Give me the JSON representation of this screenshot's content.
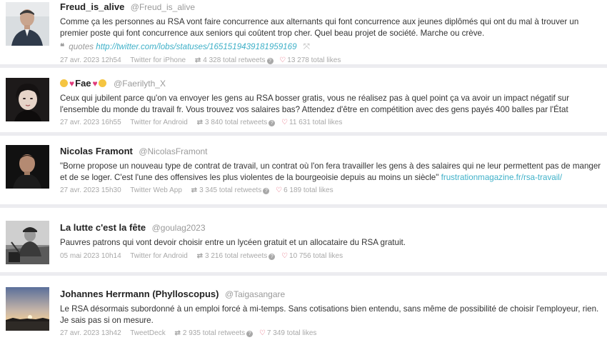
{
  "tweets": [
    {
      "name": "Freud_is_alive",
      "handle": "@Freud_is_alive",
      "text": "Comme ça les personnes au RSA vont faire concurrence aux alternants qui font concurrence aux jeunes diplômés qui ont du mal à trouver un premier poste qui font concurrence aux seniors qui coûtent trop cher. Quel beau projet de société. Marche ou crève.",
      "quote_label": "quotes",
      "quote_link": "http://twitter.com/lobs/statuses/1651519439181959169",
      "date": "27 avr. 2023 12h54",
      "client": "Twitter for iPhone",
      "retweets": "4 328 total retweets",
      "likes": "13 278 total likes"
    },
    {
      "name": "Fae",
      "handle": "@Faerilyth_X",
      "text": "Ceux qui jubilent parce qu'on va envoyer les gens au RSA bosser gratis, vous ne réalisez pas à quel point ça va avoir un impact négatif sur l'ensemble du monde du travail fr. Vous trouvez vos salaires bas? Attendez d'être en compétition avec des gens payés 400 balles par l'État",
      "date": "27 avr. 2023 16h55",
      "client": "Twitter for Android",
      "retweets": "3 840 total retweets",
      "likes": "11 631 total likes"
    },
    {
      "name": "Nicolas Framont",
      "handle": "@NicolasFramont",
      "text": "\"Borne propose un nouveau type de contrat de travail, un contrat où l'on fera travailler les gens à des salaires qui ne leur permettent pas de manger et de se loger. C'est l'une des offensives les plus violentes de la bourgeoisie depuis au moins un siècle\"",
      "link": "frustrationmagazine.fr/rsa-travail/",
      "date": "27 avr. 2023 15h30",
      "client": "Twitter Web App",
      "retweets": "3 345 total retweets",
      "likes": "6 189 total likes"
    },
    {
      "name": "La lutte c'est la fête",
      "handle": "@goulag2023",
      "text": "Pauvres patrons qui vont devoir choisir entre un lycéen gratuit et un allocataire du RSA gratuit.",
      "date": "05 mai 2023 10h14",
      "client": "Twitter for Android",
      "retweets": "3 216 total retweets",
      "likes": "10 756 total likes"
    },
    {
      "name": "Johannes Herrmann (Phylloscopus)",
      "handle": "@Taigasangare",
      "text": "Le RSA désormais subordonné à un emploi forcé à mi-temps. Sans cotisations bien entendu, sans même de possibilité de choisir l'employeur, rien. Je sais pas si on mesure.",
      "date": "27 avr. 2023 13h42",
      "client": "TweetDeck",
      "retweets": "2 935 total retweets",
      "likes": "7 349 total likes"
    }
  ],
  "icons": {
    "quote": "quote-icon",
    "retweet": "retweet-icon",
    "help": "help-icon",
    "heart": "heart-icon",
    "expand": "expand-icon"
  },
  "colors": {
    "link": "#3eb0c8",
    "heart": "#e0526a",
    "separator": "#ececf0",
    "meta": "#a8a8a8"
  }
}
